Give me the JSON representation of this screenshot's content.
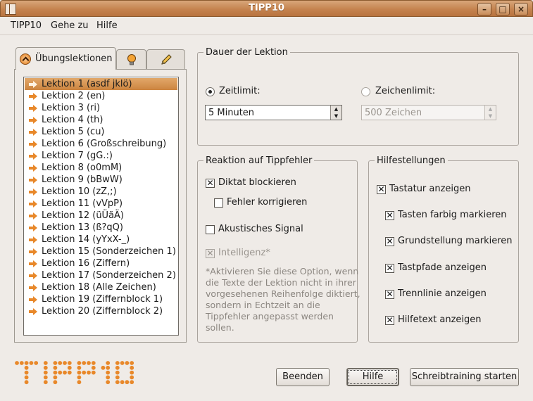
{
  "window": {
    "title": "TIPP10"
  },
  "menu": [
    "TIPP10",
    "Gehe zu",
    "Hilfe"
  ],
  "tabs": {
    "active_label": "Übungslektionen",
    "second_icon": "lightbulb-icon",
    "third_icon": "pencil-icon"
  },
  "lessons": [
    "Lektion 1 (asdf jklö)",
    "Lektion 2 (en)",
    "Lektion 3 (ri)",
    "Lektion 4 (th)",
    "Lektion 5 (cu)",
    "Lektion 6 (Großschreibung)",
    "Lektion 7 (gG.:)",
    "Lektion 8 (o0mM)",
    "Lektion 9 (bBwW)",
    "Lektion 10 (zZ,;)",
    "Lektion 11 (vVpP)",
    "Lektion 12 (üÜäÄ)",
    "Lektion 13 (ß?qQ)",
    "Lektion 14 (yYxX-_)",
    "Lektion 15 (Sonderzeichen 1)",
    "Lektion 16 (Ziffern)",
    "Lektion 17 (Sonderzeichen 2)",
    "Lektion 18 (Alle Zeichen)",
    "Lektion 19 (Ziffernblock 1)",
    "Lektion 20 (Ziffernblock 2)"
  ],
  "selected_lesson": 0,
  "duration": {
    "title": "Dauer der Lektion",
    "time_label": "Zeitlimit:",
    "time_value": "5 Minuten",
    "chars_label": "Zeichenlimit:",
    "chars_value": "500 Zeichen",
    "selected": "time"
  },
  "errors": {
    "title": "Reaktion auf Tippfehler",
    "block": {
      "label": "Diktat blockieren",
      "checked": true
    },
    "correct": {
      "label": "Fehler korrigieren",
      "checked": false
    },
    "sound": {
      "label": "Akustisches Signal",
      "checked": false
    },
    "intelligence": {
      "label": "Intelligenz*",
      "checked": true,
      "disabled": true
    },
    "note": "*Aktivieren Sie diese Option, wenn die Texte der Lektion nicht in ihrer vorgesehenen Reihenfolge diktiert, sondern in Echtzeit an die Tippfehler angepasst werden sollen."
  },
  "help": {
    "title": "Hilfestellungen",
    "keyboard": {
      "label": "Tastatur anzeigen",
      "checked": true
    },
    "color_keys": {
      "label": "Tasten farbig markieren",
      "checked": true
    },
    "home_row": {
      "label": "Grundstellung markieren",
      "checked": true
    },
    "key_paths": {
      "label": "Tastpfade anzeigen",
      "checked": true
    },
    "separator": {
      "label": "Trennlinie anzeigen",
      "checked": true
    },
    "help_text": {
      "label": "Hilfetext anzeigen",
      "checked": true
    }
  },
  "buttons": {
    "quit": "Beenden",
    "help": "Hilfe",
    "start": "Schreibtraining starten"
  },
  "logo_text": "TIPP10",
  "colors": {
    "accent": "#e8882a",
    "titlebar": "#c5834f",
    "selection": "#d9a063"
  }
}
